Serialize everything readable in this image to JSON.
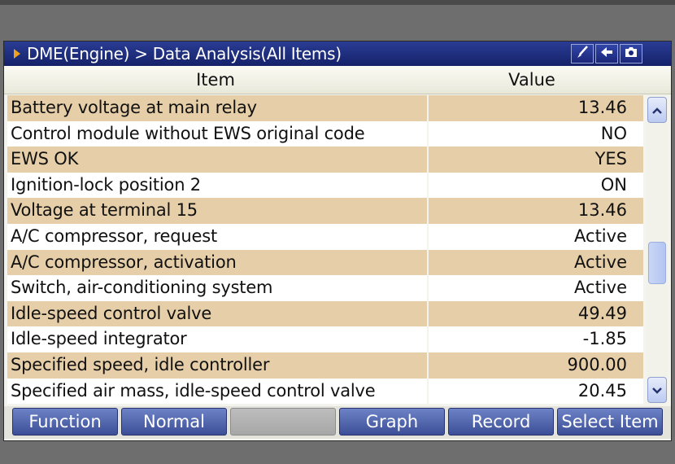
{
  "header": {
    "breadcrumb": "DME(Engine) > Data Analysis(All Items)",
    "icons": [
      "brush-icon",
      "back-arrow-icon",
      "camera-icon"
    ]
  },
  "table": {
    "columns": [
      "Item",
      "Value"
    ],
    "rows": [
      {
        "item": "Battery voltage at main relay",
        "value": "13.46"
      },
      {
        "item": "Control module without EWS original code",
        "value": "NO"
      },
      {
        "item": "EWS OK",
        "value": "YES"
      },
      {
        "item": "Ignition-lock position 2",
        "value": "ON"
      },
      {
        "item": "Voltage at terminal 15",
        "value": "13.46"
      },
      {
        "item": "A/C compressor, request",
        "value": "Active"
      },
      {
        "item": "A/C compressor, activation",
        "value": "Active"
      },
      {
        "item": "Switch, air-conditioning system",
        "value": "Active"
      },
      {
        "item": "Idle-speed control valve",
        "value": "49.49"
      },
      {
        "item": "Idle-speed integrator",
        "value": "-1.85"
      },
      {
        "item": "Specified speed, idle controller",
        "value": "900.00"
      },
      {
        "item": "Specified air mass, idle-speed control valve",
        "value": "20.45"
      }
    ]
  },
  "scroll": {
    "thumb_start": 0.47,
    "thumb_end": 0.64
  },
  "buttons": [
    {
      "label": "Function",
      "enabled": true
    },
    {
      "label": "Normal",
      "enabled": true
    },
    {
      "label": "",
      "enabled": false
    },
    {
      "label": "Graph",
      "enabled": true
    },
    {
      "label": "Record",
      "enabled": true
    },
    {
      "label": "Select Item",
      "enabled": true
    }
  ],
  "colors": {
    "title_bar": "#1c2a7c",
    "row_alt": "#e6cfa8",
    "button": "#4f63ab",
    "title_arrow": "#f0a020"
  }
}
